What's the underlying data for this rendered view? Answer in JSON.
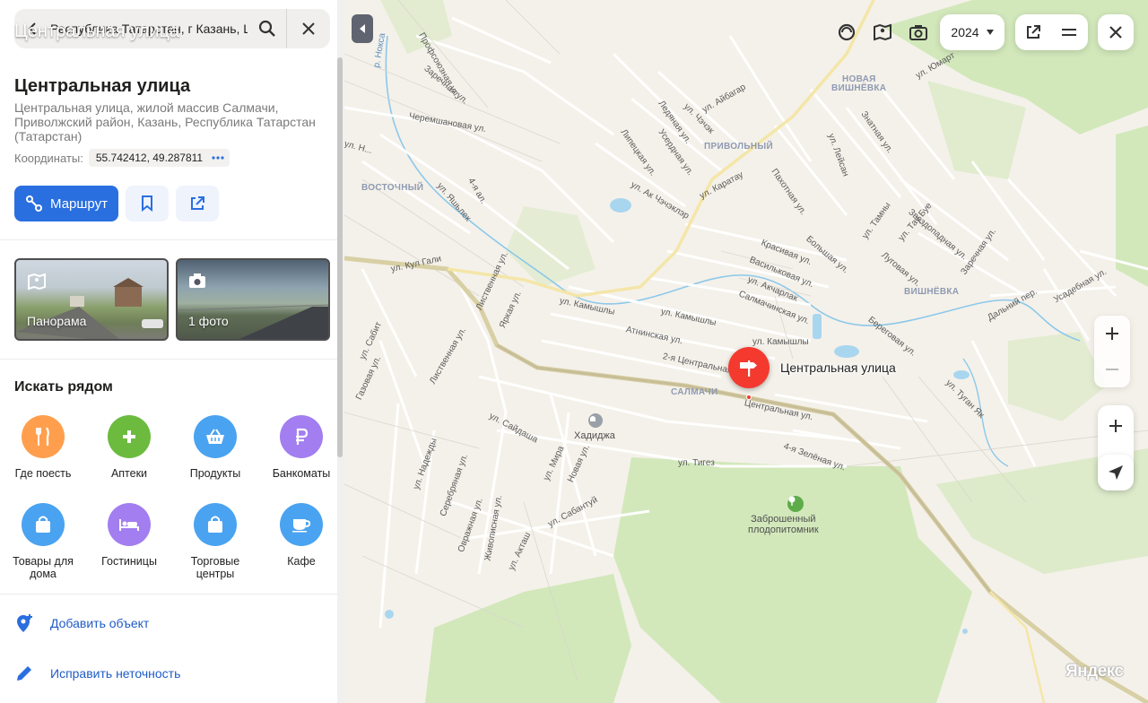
{
  "search": {
    "value": "Республика Татарстан, г Казань, Центральная улица"
  },
  "sticky_title": "Центральная улица",
  "place": {
    "title": "Центральная улица",
    "address": "Центральная улица, жилой массив Салмачи, Приволжский район, Казань, Республика Татарстан (Татарстан)",
    "coords_label": "Координаты:",
    "coords_value": "55.742412, 49.287811"
  },
  "actions": {
    "route_label": "Маршрут"
  },
  "photos": [
    {
      "label": "Панорама",
      "icon": "panorama-icon"
    },
    {
      "label": "1 фото",
      "icon": "camera-icon"
    }
  ],
  "nearby": {
    "title": "Искать рядом",
    "categories": [
      {
        "label": "Где поесть",
        "icon": "fork-knife-icon",
        "color": "#ff9f4d"
      },
      {
        "label": "Аптеки",
        "icon": "plus-icon",
        "color": "#6cbb3f"
      },
      {
        "label": "Продукты",
        "icon": "basket-icon",
        "color": "#4aa3f0"
      },
      {
        "label": "Банкоматы",
        "icon": "ruble-icon",
        "color": "#a27ef0"
      },
      {
        "label": "Товары для дома",
        "icon": "shopping-bag-icon",
        "color": "#4aa3f0"
      },
      {
        "label": "Гостиницы",
        "icon": "bed-icon",
        "color": "#a27ef0"
      },
      {
        "label": "Торговые центры",
        "icon": "shopping-bag-icon",
        "color": "#4aa3f0"
      },
      {
        "label": "Кафе",
        "icon": "cup-icon",
        "color": "#4aa3f0"
      }
    ]
  },
  "links": {
    "add_object": "Добавить объект",
    "fix_error": "Исправить неточность"
  },
  "map": {
    "year": "2024",
    "pin_label": "Центральная улица",
    "logo": "Яндекс",
    "districts": [
      "ВОСТОЧНЫЙ",
      "ПРИВОЛЬНЫЙ",
      "НОВАЯ",
      "ВИШНЁВКА",
      "ВИШНЁВКА",
      "САЛМАЧИ"
    ],
    "poi": {
      "mosque": "Хадиджа",
      "nursery_line1": "Заброшенный",
      "nursery_line2": "плодопитомник"
    },
    "streets": [
      "Профсоюзная ул.",
      "Заречная ул.",
      "Черемшановая ул.",
      "ул. Айбагар",
      "ул. Чэчэк",
      "Ледяная ул.",
      "Усердная ул.",
      "Липецкая ул.",
      "ул. Ак Чэчэклэр",
      "ул. Каратау",
      "Пахотная ул.",
      "ул. Лейсан",
      "Знатная ул.",
      "ул. Юмарт",
      "ул. Кул Гали",
      "Лиственная ул.",
      "Яркая ул.",
      "ул. Камышлы",
      "ул. Камышлы",
      "Атнинская ул.",
      "2-я Центральная",
      "ул. Камышлы",
      "Красивая ул.",
      "Васильковая ул.",
      "ул. Акчарлак",
      "Салмачинская ул.",
      "Большая ул.",
      "ул. Тамны",
      "ул. Тау Буе",
      "Звездопадная ул.",
      "Луговая ул.",
      "Береговая ул.",
      "Заречная ул.",
      "Дальний пер.",
      "Усадебная ул.",
      "ул. Сабит",
      "Газовая ул.",
      "Лиственная ул.",
      "ул. Сайдаша",
      "Центральная ул.",
      "4-я Зелёная ул.",
      "ул. Тигез",
      "ул. Мира",
      "Новая ул.",
      "ул. Надежды",
      "Серебряная ул.",
      "ул. Сабантуй",
      "Овражная ул.",
      "Живописная ул.",
      "ул. Акташ",
      "ул. Туган Як",
      "4-я ал.",
      "ул. Яшьлек",
      "ул. Н...",
      "р. Нокса"
    ]
  }
}
